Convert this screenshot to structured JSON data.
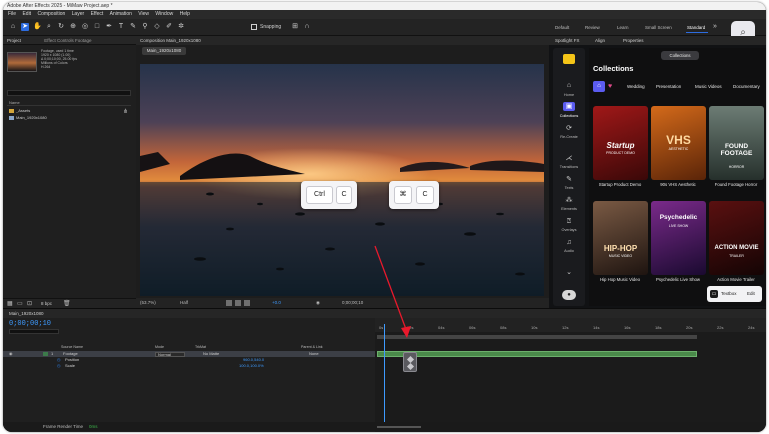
{
  "app": {
    "title": "Adobe After Effects 2025 - MiMaw Project.aep *"
  },
  "menu": [
    "File",
    "Edit",
    "Composition",
    "Layer",
    "Effect",
    "Animation",
    "View",
    "Window",
    "Help"
  ],
  "toolbar": {
    "snapping_label": "Snapping"
  },
  "workspaces": [
    "Default",
    "Review",
    "Learn",
    "Small Screen",
    "Standard"
  ],
  "project": {
    "tab_label": "Project",
    "tab_secondary": "Effect Controls Footage",
    "info": [
      "Footage, used 1 time",
      "1920 x 1080 (1.00)",
      "Δ 0;00;10;00, 25.00 fps",
      "Millions of Colors",
      "H.264"
    ],
    "search_placeholder": "",
    "column_name": "Name",
    "items": [
      {
        "name": "_Assets"
      },
      {
        "name": "Main_1920x1080"
      }
    ],
    "footer_bpc": "8 bpc"
  },
  "composition": {
    "tab_label": "Composition Main_1920x1080",
    "pill_label": "Main_1920x1080",
    "zoom": "(53.7%)",
    "resolution": "Half",
    "exposure": "+0.0",
    "timecode": "0;00;00;10"
  },
  "overlay": {
    "win_key1": "Ctrl",
    "win_key2": "C",
    "mac_key1": "⌘",
    "mac_key2": "C"
  },
  "spotlight": {
    "tabs": [
      "Spotlight FX",
      "Align",
      "Properties"
    ],
    "heading": "Collections",
    "tooltip": "Collections",
    "nav": [
      "Home",
      "Collections",
      "Re-Create",
      "Transitions",
      "Texts",
      "Elements",
      "Overlays",
      "Audio"
    ],
    "categories": [
      "Wedding",
      "Presentation",
      "Music Videos",
      "Documentary"
    ],
    "cards": [
      {
        "title": "Startup Product Demo",
        "art": "Startup",
        "art_sub": "PRODUCT DEMO"
      },
      {
        "title": "90s VHS Aesthetic",
        "art": "VHS",
        "art_sub": "AESTHETIC"
      },
      {
        "title": "Found Footage Horror",
        "art": "FOUND FOOTAGE",
        "art_sub": "HORROR"
      },
      {
        "title": "Hip Hop Music Video",
        "art": "HIP-HOP",
        "art_sub": "MUSIC VIDEO"
      },
      {
        "title": "Psychedelic Live Show",
        "art": "Psychedelic",
        "art_sub": "LIVE SHOW"
      },
      {
        "title": "Action Movie Trailer",
        "art": "ACTION MOVIE",
        "art_sub": "TRAILER"
      }
    ],
    "textbox_label": "Textbox",
    "edit_label": "Edit"
  },
  "timeline": {
    "tab_label": "Main_1920x1080",
    "time": "0;00;00;10",
    "columns": {
      "source": "Source Name",
      "mode": "Mode",
      "trkmat": "TrkMat",
      "parent": "Parent & Link"
    },
    "layers": [
      {
        "num": "1",
        "name": "Footage",
        "mode": "Normal",
        "trkmat": "No Matte",
        "parent": "None"
      },
      {
        "name": "Position",
        "value": "960.0,540.0"
      },
      {
        "name": "Scale",
        "value": "100.0,100.0%"
      }
    ],
    "ruler": [
      "0s",
      "02s",
      "04s",
      "06s",
      "08s",
      "10s",
      "12s",
      "14s",
      "16s",
      "18s",
      "20s",
      "22s",
      "24s"
    ],
    "footer": "Frame Render Time",
    "footer_value": "0ms"
  },
  "colors": {
    "accent": "#2d6cdf",
    "time": "#3e9bff",
    "brand": "#f5c518",
    "arrow": "#e8192c"
  }
}
